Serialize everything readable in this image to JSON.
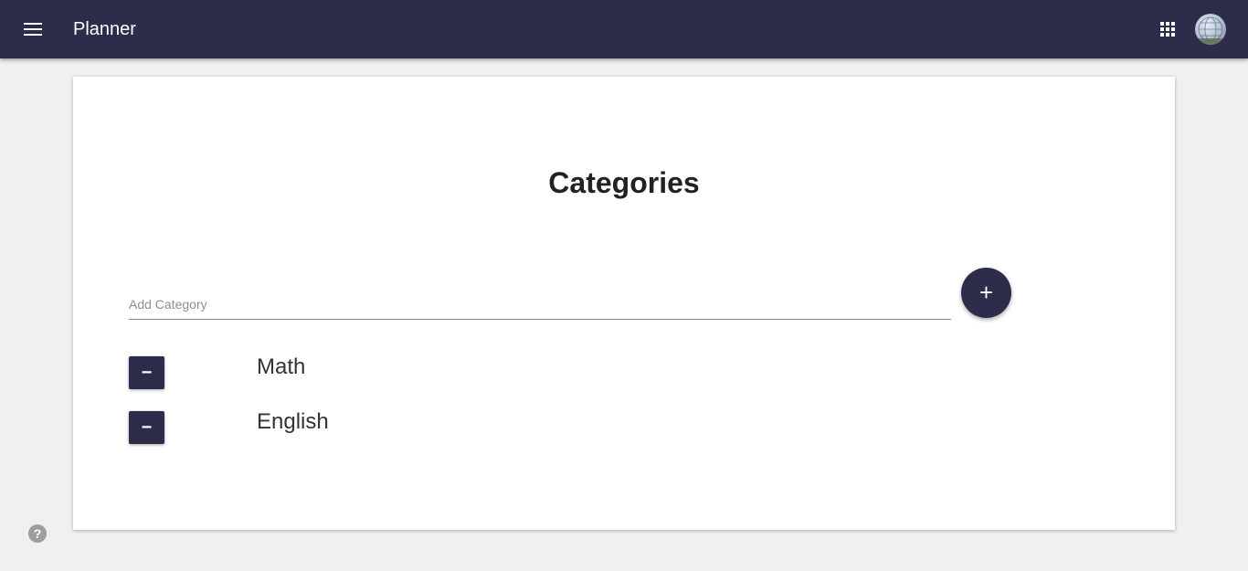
{
  "header": {
    "title": "Planner",
    "menu_icon": "menu-icon",
    "apps_icon": "apps-grid-icon",
    "avatar_icon": "avatar-globe",
    "bar_color": "#2d2d4b"
  },
  "main": {
    "title": "Categories",
    "add_field": {
      "placeholder": "Add Category",
      "value": ""
    },
    "add_button": {
      "label": "+",
      "icon": "plus-icon"
    },
    "categories": [
      {
        "name": "Math",
        "remove_label": "−"
      },
      {
        "name": "English",
        "remove_label": "−"
      }
    ]
  },
  "footer": {
    "help_label": "?"
  }
}
